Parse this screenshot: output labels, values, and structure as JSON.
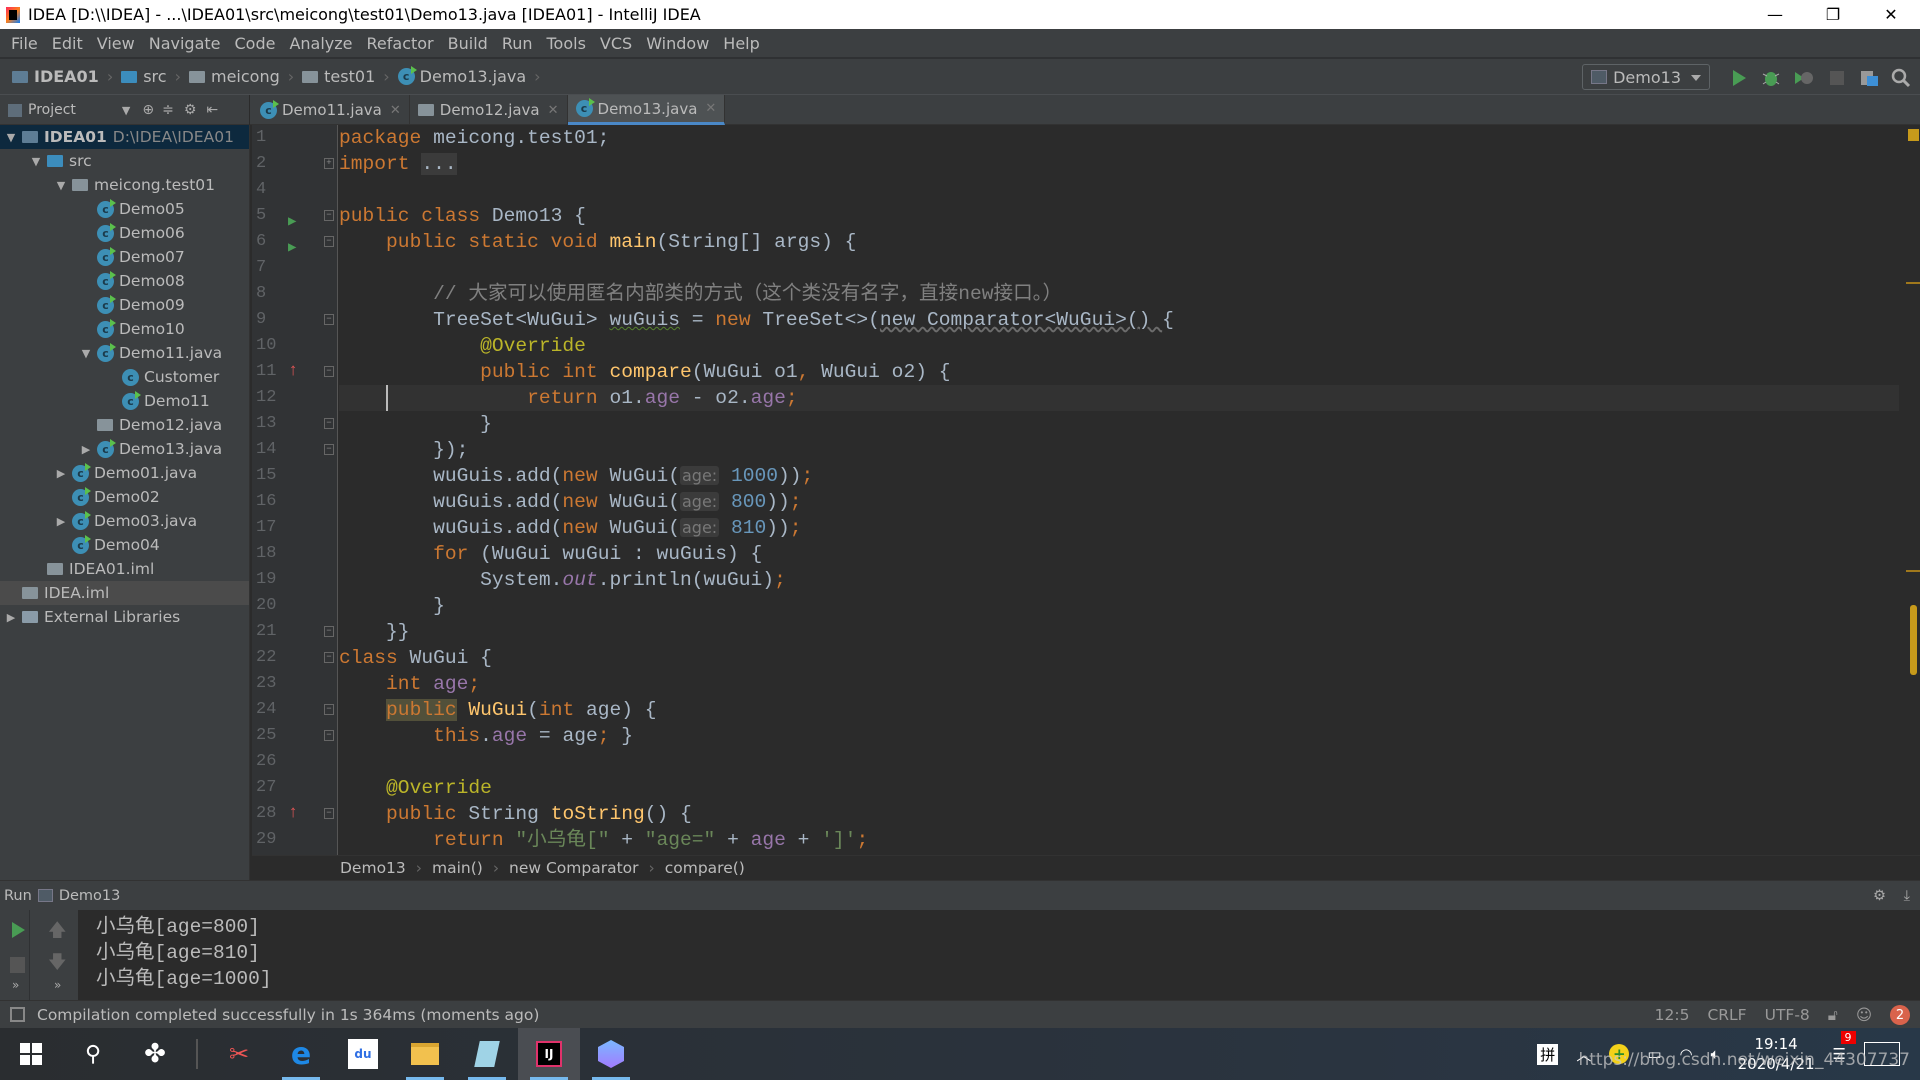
{
  "window": {
    "title": "IDEA [D:\\\\IDEA] - ...\\IDEA01\\src\\meicong\\test01\\Demo13.java [IDEA01] - IntelliJ IDEA",
    "minimize": "—",
    "restore": "❐",
    "close": "✕"
  },
  "menu": [
    "File",
    "Edit",
    "View",
    "Navigate",
    "Code",
    "Analyze",
    "Refactor",
    "Build",
    "Run",
    "Tools",
    "VCS",
    "Window",
    "Help"
  ],
  "nav": {
    "crumbs": [
      "IDEA01",
      "src",
      "meicong",
      "test01",
      "Demo13.java"
    ],
    "run_config": "Demo13"
  },
  "project_panel": {
    "title": "Project"
  },
  "tabs": [
    {
      "label": "Demo11.java",
      "active": false
    },
    {
      "label": "Demo12.java",
      "active": false
    },
    {
      "label": "Demo13.java",
      "active": true
    }
  ],
  "tree": [
    {
      "level": 0,
      "arrow": "down",
      "icon": "module",
      "label": "IDEA01",
      "extra": "D:\\IDEA\\IDEA01",
      "sel": true,
      "bold": true
    },
    {
      "level": 1,
      "arrow": "down",
      "icon": "folder-src",
      "label": "src"
    },
    {
      "level": 2,
      "arrow": "down",
      "icon": "package",
      "label": "meicong.test01"
    },
    {
      "level": 3,
      "icon": "class",
      "label": "Demo05"
    },
    {
      "level": 3,
      "icon": "class",
      "label": "Demo06"
    },
    {
      "level": 3,
      "icon": "class",
      "label": "Demo07"
    },
    {
      "level": 3,
      "icon": "class",
      "label": "Demo08"
    },
    {
      "level": 3,
      "icon": "class",
      "label": "Demo09"
    },
    {
      "level": 3,
      "icon": "class",
      "label": "Demo10"
    },
    {
      "level": 3,
      "arrow": "down",
      "icon": "class",
      "label": "Demo11.java"
    },
    {
      "level": 4,
      "icon": "class-plain",
      "label": "Customer"
    },
    {
      "level": 4,
      "icon": "class",
      "label": "Demo11"
    },
    {
      "level": 3,
      "icon": "java-file",
      "label": "Demo12.java"
    },
    {
      "level": 3,
      "arrow": "right",
      "icon": "class",
      "label": "Demo13.java"
    },
    {
      "level": 2,
      "arrow": "right",
      "icon": "class",
      "label": "Demo01.java"
    },
    {
      "level": 2,
      "icon": "class",
      "label": "Demo02"
    },
    {
      "level": 2,
      "arrow": "right",
      "icon": "class",
      "label": "Demo03.java"
    },
    {
      "level": 2,
      "icon": "class",
      "label": "Demo04"
    },
    {
      "level": 1,
      "icon": "iml",
      "label": "IDEA01.iml"
    },
    {
      "level": 0,
      "icon": "iml",
      "label": "IDEA.iml",
      "hl": true
    },
    {
      "level": 0,
      "arrow": "right",
      "icon": "libraries",
      "label": "External Libraries"
    }
  ],
  "editor": {
    "lines": [
      {
        "n": "1",
        "t": [
          [
            "package",
            "kw"
          ],
          [
            " meicong.test01;",
            ""
          ]
        ]
      },
      {
        "n": "2",
        "fold": true,
        "t": [
          [
            "import",
            "kw"
          ],
          [
            " ",
            ""
          ],
          [
            "...",
            "fold"
          ]
        ]
      },
      {
        "n": "4",
        "t": []
      },
      {
        "n": "5",
        "run": true,
        "fold": true,
        "t": [
          [
            "public class",
            "kw"
          ],
          [
            " Demo13 {",
            ""
          ]
        ]
      },
      {
        "n": "6",
        "run": true,
        "fold": true,
        "t": [
          [
            "    ",
            ""
          ],
          [
            "public static void",
            "kw"
          ],
          [
            " ",
            ""
          ],
          [
            "main",
            "fn"
          ],
          [
            "(String[] args) {",
            ""
          ]
        ]
      },
      {
        "n": "7",
        "t": []
      },
      {
        "n": "8",
        "t": [
          [
            "        ",
            ""
          ],
          [
            "// 大家可以使用匿名内部类的方式（这个类没有名字，直接new接口。）",
            "cm"
          ]
        ]
      },
      {
        "n": "9",
        "fold": true,
        "t": [
          [
            "        TreeSet<WuGui> ",
            ""
          ],
          [
            "wuGuis",
            "ul"
          ],
          [
            " = ",
            ""
          ],
          [
            "new",
            "kw"
          ],
          [
            " TreeSet<>(",
            ""
          ],
          [
            "new Comparator<WuGui>() ",
            "ulg"
          ],
          [
            "{",
            ""
          ]
        ]
      },
      {
        "n": "10",
        "t": [
          [
            "            ",
            ""
          ],
          [
            "@Override",
            "ann"
          ]
        ]
      },
      {
        "n": "11",
        "impl": true,
        "fold": true,
        "t": [
          [
            "            ",
            ""
          ],
          [
            "public int",
            "kw"
          ],
          [
            " ",
            ""
          ],
          [
            "compare",
            "fn"
          ],
          [
            "(WuGui o1",
            ""
          ],
          [
            ",",
            "kw"
          ],
          [
            " WuGui o2) {",
            ""
          ]
        ]
      },
      {
        "n": "12",
        "cur": true,
        "t": [
          [
            "                ",
            ""
          ],
          [
            "return",
            "kw"
          ],
          [
            " o1.",
            ""
          ],
          [
            "age",
            "fld"
          ],
          [
            " - o2.",
            ""
          ],
          [
            "age",
            "fld"
          ],
          [
            ";",
            "kw"
          ]
        ]
      },
      {
        "n": "13",
        "fold": true,
        "t": [
          [
            "            }",
            ""
          ]
        ]
      },
      {
        "n": "14",
        "fold": true,
        "t": [
          [
            "        });",
            ""
          ]
        ]
      },
      {
        "n": "15",
        "t": [
          [
            "        wuGuis.add(",
            ""
          ],
          [
            "new",
            "kw"
          ],
          [
            " WuGui(",
            ""
          ],
          [
            "age:",
            "hint"
          ],
          [
            " ",
            ""
          ],
          [
            "1000",
            "num"
          ],
          [
            "))",
            ""
          ],
          [
            ";",
            "kw"
          ]
        ]
      },
      {
        "n": "16",
        "t": [
          [
            "        wuGuis.add(",
            ""
          ],
          [
            "new",
            "kw"
          ],
          [
            " WuGui(",
            ""
          ],
          [
            "age:",
            "hint"
          ],
          [
            " ",
            ""
          ],
          [
            "800",
            "num"
          ],
          [
            "))",
            ""
          ],
          [
            ";",
            "kw"
          ]
        ]
      },
      {
        "n": "17",
        "t": [
          [
            "        wuGuis.add(",
            ""
          ],
          [
            "new",
            "kw"
          ],
          [
            " WuGui(",
            ""
          ],
          [
            "age:",
            "hint"
          ],
          [
            " ",
            ""
          ],
          [
            "810",
            "num"
          ],
          [
            "))",
            ""
          ],
          [
            ";",
            "kw"
          ]
        ]
      },
      {
        "n": "18",
        "t": [
          [
            "        ",
            ""
          ],
          [
            "for",
            "kw"
          ],
          [
            " (WuGui wuGui : wuGuis) {",
            ""
          ]
        ]
      },
      {
        "n": "19",
        "t": [
          [
            "            System.",
            ""
          ],
          [
            "out",
            "st"
          ],
          [
            ".println(wuGui)",
            ""
          ],
          [
            ";",
            "kw"
          ]
        ]
      },
      {
        "n": "20",
        "t": [
          [
            "        }",
            ""
          ]
        ]
      },
      {
        "n": "21",
        "fold": true,
        "t": [
          [
            "    }}",
            ""
          ]
        ]
      },
      {
        "n": "22",
        "fold": true,
        "t": [
          [
            "class",
            "kw"
          ],
          [
            " WuGui {",
            ""
          ]
        ]
      },
      {
        "n": "23",
        "t": [
          [
            "    ",
            ""
          ],
          [
            "int",
            "kw"
          ],
          [
            " ",
            ""
          ],
          [
            "age",
            "fld"
          ],
          [
            ";",
            "kw"
          ]
        ]
      },
      {
        "n": "24",
        "fold": true,
        "t": [
          [
            "    ",
            ""
          ],
          [
            "public",
            "kw hlw"
          ],
          [
            " ",
            ""
          ],
          [
            "WuGui",
            "fn"
          ],
          [
            "(",
            ""
          ],
          [
            "int",
            "kw"
          ],
          [
            " age) {",
            ""
          ]
        ]
      },
      {
        "n": "25",
        "fold": true,
        "t": [
          [
            "        ",
            ""
          ],
          [
            "this",
            "kw"
          ],
          [
            ".",
            ""
          ],
          [
            "age",
            "fld"
          ],
          [
            " = age",
            ""
          ],
          [
            ";",
            "kw"
          ],
          [
            " }",
            ""
          ]
        ]
      },
      {
        "n": "26",
        "t": []
      },
      {
        "n": "27",
        "t": [
          [
            "    ",
            ""
          ],
          [
            "@Override",
            "ann"
          ]
        ]
      },
      {
        "n": "28",
        "over": true,
        "fold": true,
        "t": [
          [
            "    ",
            ""
          ],
          [
            "public",
            "kw"
          ],
          [
            " String ",
            ""
          ],
          [
            "toString",
            "fn"
          ],
          [
            "() {",
            ""
          ]
        ]
      },
      {
        "n": "29",
        "t": [
          [
            "        ",
            ""
          ],
          [
            "return",
            "kw"
          ],
          [
            " ",
            ""
          ],
          [
            "\"小乌龟[\"",
            "str"
          ],
          [
            " + ",
            ""
          ],
          [
            "\"age=\"",
            "str"
          ],
          [
            " + ",
            ""
          ],
          [
            "age",
            "fld"
          ],
          [
            " + ",
            ""
          ],
          [
            "']'",
            "str"
          ],
          [
            ";",
            "kw"
          ]
        ]
      }
    ]
  },
  "breadcrumb": [
    "Demo13",
    "main()",
    "new Comparator",
    "compare()"
  ],
  "run": {
    "label": "Run",
    "config": "Demo13",
    "output": [
      "小乌龟[age=800]",
      "小乌龟[age=810]",
      "小乌龟[age=1000]"
    ]
  },
  "status": {
    "message": "Compilation completed successfully in 1s 364ms (moments ago)",
    "position": "12:5",
    "line_sep": "CRLF",
    "encoding": "UTF-8",
    "notifications": "2"
  },
  "taskbar": {
    "ime": "拼",
    "time": "19:14",
    "date": "2020/4/21",
    "notif_count": "9"
  },
  "watermark": "https://blog.csdn.net/weixin_44307737",
  "colors": {
    "keyword": "#cc7832",
    "function": "#ffc66d",
    "annotation": "#bbb529",
    "field": "#9876aa",
    "number": "#6897bb",
    "string": "#6a8759",
    "accent": "#4a88c7"
  }
}
